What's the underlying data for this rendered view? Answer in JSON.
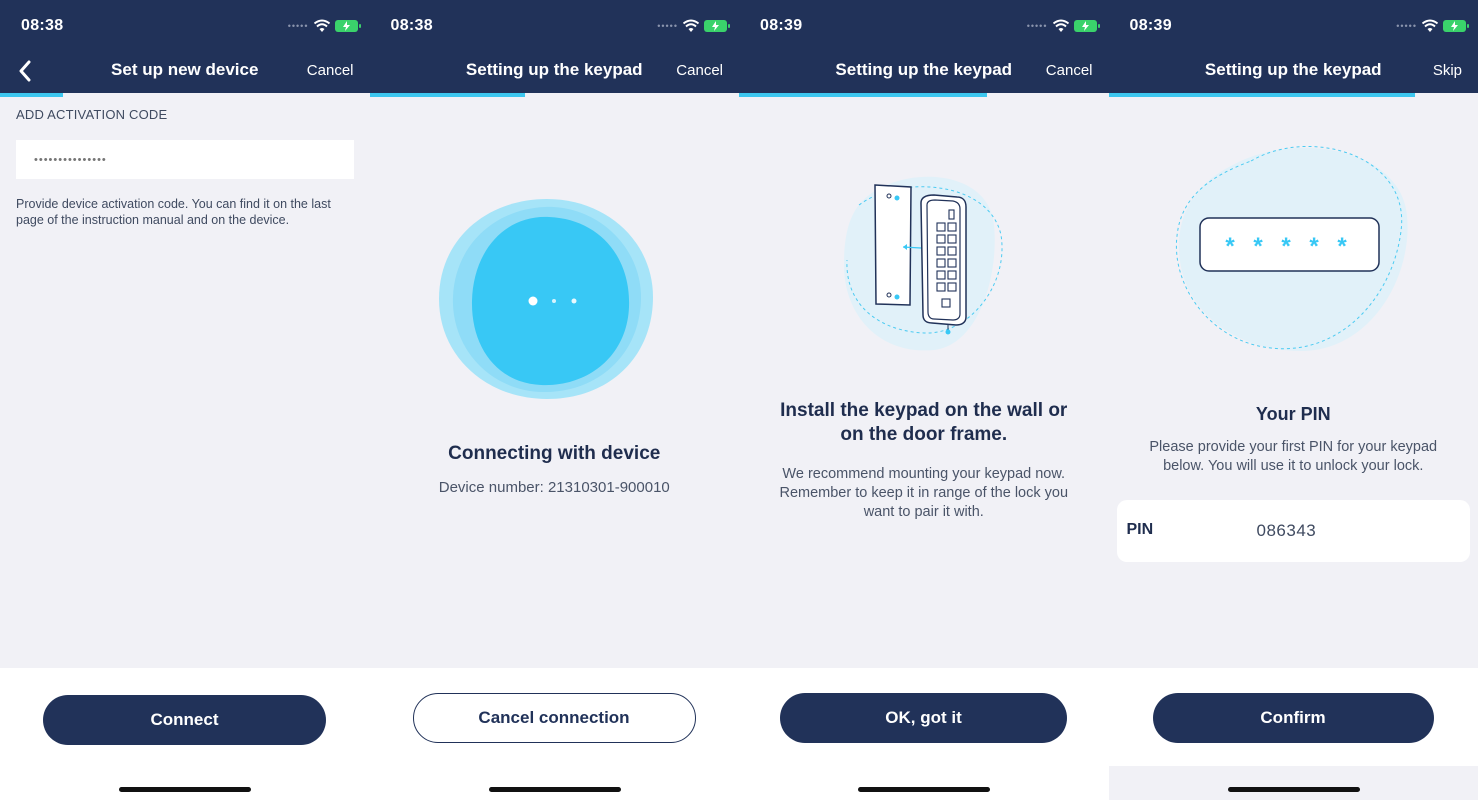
{
  "screens": [
    {
      "time": "08:38",
      "title": "Set up new device",
      "right_action": "Cancel",
      "field_label": "ADD ACTIVATION CODE",
      "field_placeholder": "•••••••••••••••",
      "help_text": "Provide device activation code. You can find it on the last page of the instruction manual and on the device.",
      "button": "Connect",
      "progress": 0.17
    },
    {
      "time": "08:38",
      "title": "Setting up the keypad",
      "right_action": "Cancel",
      "heading": "Connecting with device",
      "subtext": "Device number: 21310301-900010",
      "button": "Cancel connection",
      "progress": 0.42
    },
    {
      "time": "08:39",
      "title": "Setting up the keypad",
      "right_action": "Cancel",
      "heading": "Install the keypad on the wall or on the door frame.",
      "subtext": "We recommend mounting your keypad now. Remember to keep it in range of the lock you want to pair it with.",
      "button": "OK, got it",
      "progress": 0.67
    },
    {
      "time": "08:39",
      "title": "Setting up the keypad",
      "right_action": "Skip",
      "heading": "Your PIN",
      "subtext": "Please provide your first PIN for your keypad below. You will use it to unlock your lock.",
      "pin_mask": "* * * * *",
      "pin_label": "PIN",
      "pin_value": "086343",
      "button": "Confirm",
      "progress": 0.83
    }
  ],
  "colors": {
    "navbar": "#213259",
    "accent": "#3dc7ef",
    "background": "#f1f1f6",
    "battery": "#3ad26b"
  },
  "icons": [
    "back-chevron-icon",
    "wifi-icon",
    "battery-charging-icon",
    "signal-icon"
  ]
}
